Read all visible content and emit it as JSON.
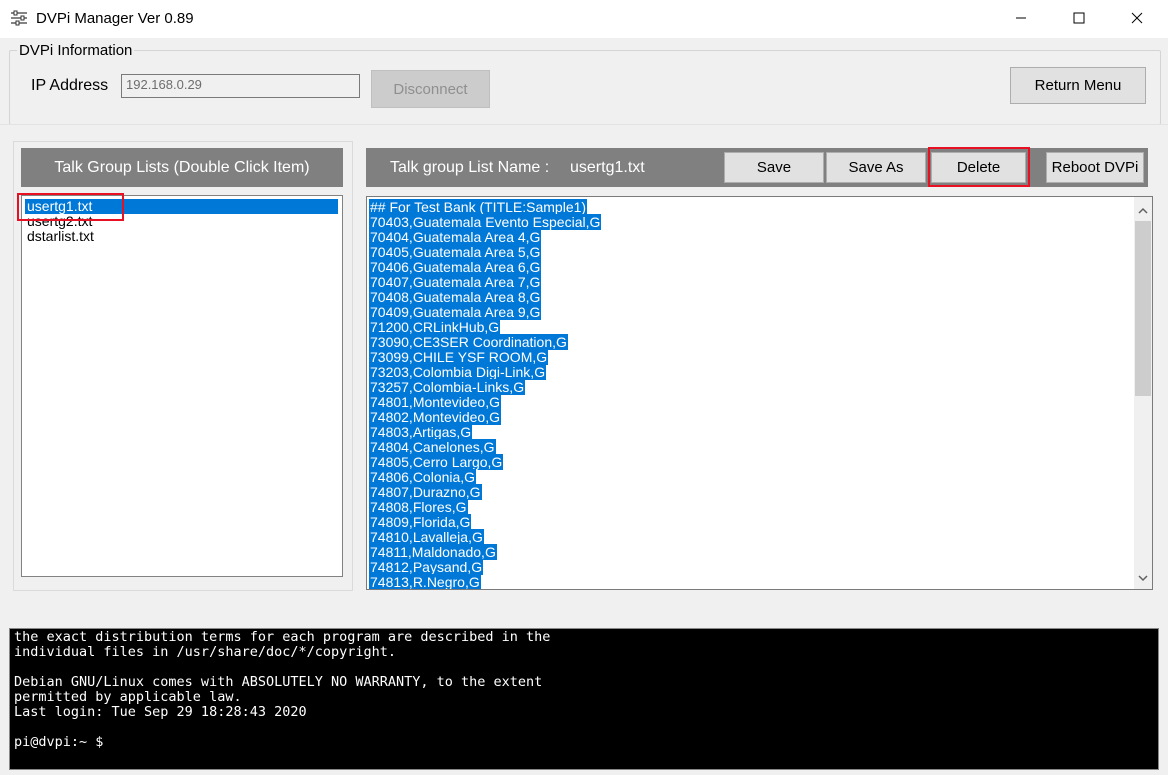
{
  "window": {
    "title": "DVPi Manager Ver 0.89",
    "icons": {
      "app": "sliders-icon",
      "minimize": "minimize-icon",
      "maximize": "maximize-icon",
      "close": "close-icon"
    }
  },
  "info": {
    "legend": "DVPi Information",
    "ip_label": "IP Address",
    "ip_value": "192.168.0.29",
    "disconnect_label": "Disconnect",
    "return_menu_label": "Return Menu"
  },
  "talk_group": {
    "header": "Talk Group Lists (Double Click Item)",
    "files": [
      "usertg1.txt",
      "usertg2.txt",
      "dstarlist.txt"
    ],
    "selected_index": 0
  },
  "editor": {
    "list_name_label": "Talk group List Name :",
    "list_name_value": "usertg1.txt",
    "save_label": "Save",
    "save_as_label": "Save As",
    "delete_label": "Delete",
    "reboot_label": "Reboot DVPi",
    "lines": [
      "## For Test Bank  (TITLE:Sample1)",
      "70403,Guatemala Evento Especial,G",
      "70404,Guatemala Area 4,G",
      "70405,Guatemala Area 5,G",
      "70406,Guatemala Area 6,G",
      "70407,Guatemala Area 7,G",
      "70408,Guatemala Area 8,G",
      "70409,Guatemala Area 9,G",
      "71200,CRLinkHub,G",
      "73090,CE3SER Coordination,G",
      "73099,CHILE YSF ROOM,G",
      "73203,Colombia Digi-Link,G",
      "73257,Colombia-Links,G",
      "74801,Montevideo,G",
      "74802,Montevideo,G",
      "74803,Artigas,G",
      "74804,Canelones,G",
      "74805,Cerro Largo,G",
      "74806,Colonia,G",
      "74807,Durazno,G",
      "74808,Flores,G",
      "74809,Florida,G",
      "74810,Lavalleja,G",
      "74811,Maldonado,G",
      "74812,Paysand,G",
      "74813,R.Negro,G"
    ]
  },
  "terminal": {
    "lines": [
      "the exact distribution terms for each program are described in the",
      "individual files in /usr/share/doc/*/copyright.",
      "",
      "Debian GNU/Linux comes with ABSOLUTELY NO WARRANTY, to the extent",
      "permitted by applicable law.",
      "Last login: Tue Sep 29 18:28:43 2020",
      "",
      "pi@dvpi:~ $"
    ]
  },
  "colors": {
    "selection": "#0078d7",
    "highlight_box": "#e81123",
    "header_bg": "#808080"
  }
}
